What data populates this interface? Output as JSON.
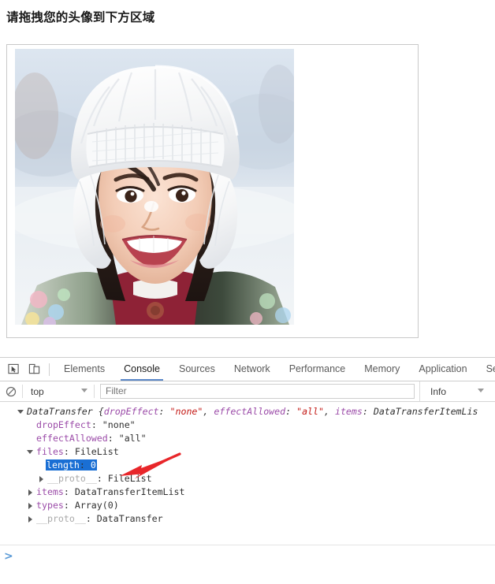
{
  "page": {
    "heading": "请拖拽您的头像到下方区域",
    "drop_zone_label": "avatar drop zone",
    "photo_alt": "Smiling young woman wearing a white knit winter hat with ear flaps in the snow"
  },
  "devtools": {
    "toolbar_icons": [
      {
        "name": "inspect-element-icon",
        "glyph": "inspect"
      },
      {
        "name": "device-toolbar-icon",
        "glyph": "device"
      }
    ],
    "tabs": [
      {
        "label": "Elements",
        "active": false
      },
      {
        "label": "Console",
        "active": true
      },
      {
        "label": "Sources",
        "active": false
      },
      {
        "label": "Network",
        "active": false
      },
      {
        "label": "Performance",
        "active": false
      },
      {
        "label": "Memory",
        "active": false
      },
      {
        "label": "Application",
        "active": false
      },
      {
        "label": "Se",
        "active": false
      }
    ],
    "filter_bar": {
      "clear_icon": "clear-console-icon",
      "context": "top",
      "filter_placeholder": "Filter",
      "filter_value": "",
      "level": "Info"
    },
    "console": {
      "rows": [
        {
          "indent": 0,
          "triangle": "open",
          "type": "object-preview",
          "text": "DataTransfer {dropEffect: \"none\", effectAllowed: \"all\", items: DataTransferItemLis",
          "segments": [
            {
              "t": "DataTransfer {",
              "c": "plain-italic"
            },
            {
              "t": "dropEffect",
              "c": "prop-italic"
            },
            {
              "t": ": ",
              "c": "plain-italic"
            },
            {
              "t": "\"none\"",
              "c": "str-italic"
            },
            {
              "t": ", ",
              "c": "plain-italic"
            },
            {
              "t": "effectAllowed",
              "c": "prop-italic"
            },
            {
              "t": ": ",
              "c": "plain-italic"
            },
            {
              "t": "\"all\"",
              "c": "str-italic"
            },
            {
              "t": ", ",
              "c": "plain-italic"
            },
            {
              "t": "items",
              "c": "prop-italic"
            },
            {
              "t": ": ",
              "c": "plain-italic"
            },
            {
              "t": "DataTransferItemLis",
              "c": "plain-italic"
            }
          ]
        },
        {
          "indent": 1,
          "triangle": "none",
          "segments": [
            {
              "t": "dropEffect",
              "c": "prop"
            },
            {
              "t": ": ",
              "c": "plain"
            },
            {
              "t": "\"none\"",
              "c": "plain"
            }
          ]
        },
        {
          "indent": 1,
          "triangle": "none",
          "segments": [
            {
              "t": "effectAllowed",
              "c": "prop"
            },
            {
              "t": ": ",
              "c": "plain"
            },
            {
              "t": "\"all\"",
              "c": "plain"
            }
          ]
        },
        {
          "indent": 1,
          "triangle": "open",
          "segments": [
            {
              "t": "files",
              "c": "prop"
            },
            {
              "t": ": ",
              "c": "plain"
            },
            {
              "t": "FileList",
              "c": "plain"
            }
          ]
        },
        {
          "indent": 2,
          "triangle": "none",
          "selected": true,
          "segments": [
            {
              "t": "length",
              "c": "prop"
            },
            {
              "t": ": ",
              "c": "plain"
            },
            {
              "t": "0",
              "c": "num"
            }
          ]
        },
        {
          "indent": 2,
          "triangle": "closed",
          "segments": [
            {
              "t": "__proto__",
              "c": "proto"
            },
            {
              "t": ": ",
              "c": "plain"
            },
            {
              "t": "FileList",
              "c": "plain"
            }
          ]
        },
        {
          "indent": 1,
          "triangle": "closed",
          "segments": [
            {
              "t": "items",
              "c": "prop"
            },
            {
              "t": ": ",
              "c": "plain"
            },
            {
              "t": "DataTransferItemList",
              "c": "plain"
            }
          ]
        },
        {
          "indent": 1,
          "triangle": "closed",
          "segments": [
            {
              "t": "types",
              "c": "prop"
            },
            {
              "t": ": ",
              "c": "plain"
            },
            {
              "t": "Array(0)",
              "c": "plain"
            }
          ]
        },
        {
          "indent": 1,
          "triangle": "closed",
          "segments": [
            {
              "t": "__proto__",
              "c": "proto"
            },
            {
              "t": ": ",
              "c": "plain"
            },
            {
              "t": "DataTransfer",
              "c": "plain"
            }
          ]
        }
      ],
      "annotation_arrow": {
        "name": "red-pointer-arrow",
        "color": "#e8262a",
        "points_to": "length: 0"
      }
    },
    "prompt": {
      "chevron": ">",
      "value": ""
    }
  },
  "colors": {
    "accent_tab_underline": "#5a87c9",
    "selection_blue": "#1a6fd4",
    "arrow_red": "#e8262a",
    "property_purple": "#9b4ba8",
    "string_red": "#c41a16",
    "number_blue": "#1c00cf"
  }
}
